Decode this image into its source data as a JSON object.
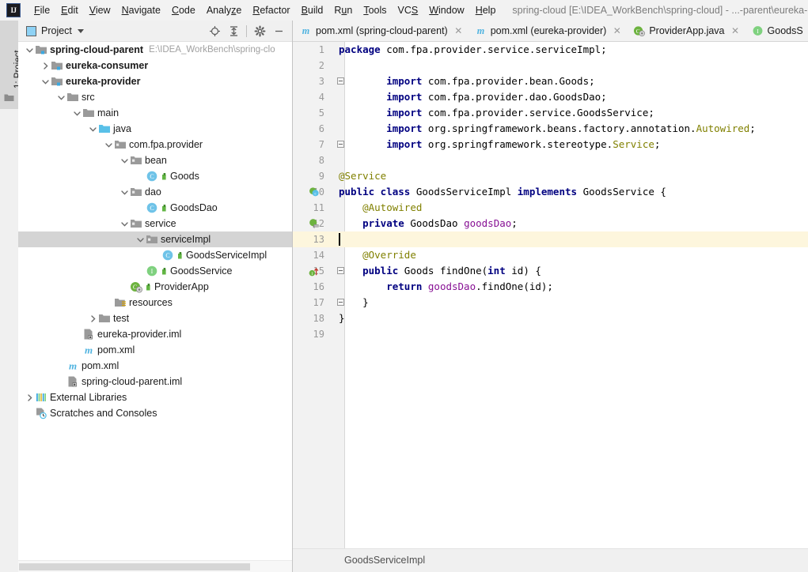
{
  "window": {
    "title": "spring-cloud [E:\\IDEA_WorkBench\\spring-cloud] - ...-parent\\eureka-p",
    "logo": "intellij-idea-logo"
  },
  "menubar": {
    "items": [
      {
        "label": "File",
        "mnemonic": "F"
      },
      {
        "label": "Edit",
        "mnemonic": "E"
      },
      {
        "label": "View",
        "mnemonic": "V"
      },
      {
        "label": "Navigate",
        "mnemonic": "N"
      },
      {
        "label": "Code",
        "mnemonic": "C"
      },
      {
        "label": "Analyze",
        "mnemonic": "z"
      },
      {
        "label": "Refactor",
        "mnemonic": "R"
      },
      {
        "label": "Build",
        "mnemonic": "B"
      },
      {
        "label": "Run",
        "mnemonic": "u"
      },
      {
        "label": "Tools",
        "mnemonic": "T"
      },
      {
        "label": "VCS",
        "mnemonic": "S"
      },
      {
        "label": "Window",
        "mnemonic": "W"
      },
      {
        "label": "Help",
        "mnemonic": "H"
      }
    ]
  },
  "toolstrip": {
    "project_tab": "1: Project",
    "project_tab_num": "1",
    "project_tab_rest": ": Project"
  },
  "project_panel": {
    "title": "Project",
    "tools": [
      {
        "name": "locate-icon",
        "label": "Select Opened File"
      },
      {
        "name": "collapse-all-icon",
        "label": "Collapse All"
      },
      {
        "name": "gear-icon",
        "label": "Settings"
      },
      {
        "name": "minimize-icon",
        "label": "Hide"
      }
    ],
    "tree": [
      {
        "label": "spring-cloud-parent",
        "path": "E:\\IDEA_WorkBench\\spring-clo",
        "depth": 0,
        "arrow": "down",
        "icon": "module-folder-icon",
        "bold": true,
        "badge": false,
        "selected": false
      },
      {
        "label": "eureka-consumer",
        "path": "",
        "depth": 1,
        "arrow": "right",
        "icon": "module-folder-icon",
        "bold": true,
        "badge": false,
        "selected": false
      },
      {
        "label": "eureka-provider",
        "path": "",
        "depth": 1,
        "arrow": "down",
        "icon": "module-folder-icon",
        "bold": true,
        "badge": false,
        "selected": false
      },
      {
        "label": "src",
        "path": "",
        "depth": 2,
        "arrow": "down",
        "icon": "folder-icon",
        "bold": false,
        "badge": false,
        "selected": false
      },
      {
        "label": "main",
        "path": "",
        "depth": 3,
        "arrow": "down",
        "icon": "folder-icon",
        "bold": false,
        "badge": false,
        "selected": false
      },
      {
        "label": "java",
        "path": "",
        "depth": 4,
        "arrow": "down",
        "icon": "source-root-folder-icon",
        "bold": false,
        "badge": false,
        "selected": false
      },
      {
        "label": "com.fpa.provider",
        "path": "",
        "depth": 5,
        "arrow": "down",
        "icon": "package-icon",
        "bold": false,
        "badge": false,
        "selected": false
      },
      {
        "label": "bean",
        "path": "",
        "depth": 6,
        "arrow": "down",
        "icon": "package-icon",
        "bold": false,
        "badge": false,
        "selected": false
      },
      {
        "label": "Goods",
        "path": "",
        "depth": 7,
        "arrow": "none",
        "icon": "java-class-icon",
        "bold": false,
        "badge": true,
        "selected": false
      },
      {
        "label": "dao",
        "path": "",
        "depth": 6,
        "arrow": "down",
        "icon": "package-icon",
        "bold": false,
        "badge": false,
        "selected": false
      },
      {
        "label": "GoodsDao",
        "path": "",
        "depth": 7,
        "arrow": "none",
        "icon": "java-class-icon",
        "bold": false,
        "badge": true,
        "selected": false
      },
      {
        "label": "service",
        "path": "",
        "depth": 6,
        "arrow": "down",
        "icon": "package-icon",
        "bold": false,
        "badge": false,
        "selected": false
      },
      {
        "label": "serviceImpl",
        "path": "",
        "depth": 7,
        "arrow": "down",
        "icon": "package-icon",
        "bold": false,
        "badge": false,
        "selected": true
      },
      {
        "label": "GoodsServiceImpl",
        "path": "",
        "depth": 8,
        "arrow": "none",
        "icon": "java-class-icon",
        "bold": false,
        "badge": true,
        "selected": false
      },
      {
        "label": "GoodsService",
        "path": "",
        "depth": 7,
        "arrow": "none",
        "icon": "java-interface-icon",
        "bold": false,
        "badge": true,
        "selected": false
      },
      {
        "label": "ProviderApp",
        "path": "",
        "depth": 6,
        "arrow": "none",
        "icon": "spring-boot-class-icon",
        "bold": false,
        "badge": true,
        "selected": false
      },
      {
        "label": "resources",
        "path": "",
        "depth": 5,
        "arrow": "none",
        "icon": "resources-folder-icon",
        "bold": false,
        "badge": false,
        "selected": false
      },
      {
        "label": "test",
        "path": "",
        "depth": 4,
        "arrow": "right",
        "icon": "folder-icon",
        "bold": false,
        "badge": false,
        "selected": false
      },
      {
        "label": "eureka-provider.iml",
        "path": "",
        "depth": 3,
        "arrow": "none",
        "icon": "iml-file-icon",
        "bold": false,
        "badge": false,
        "selected": false
      },
      {
        "label": "pom.xml",
        "path": "",
        "depth": 3,
        "arrow": "none",
        "icon": "maven-file-icon",
        "bold": false,
        "badge": false,
        "selected": false
      },
      {
        "label": "pom.xml",
        "path": "",
        "depth": 2,
        "arrow": "none",
        "icon": "maven-file-icon",
        "bold": false,
        "badge": false,
        "selected": false
      },
      {
        "label": "spring-cloud-parent.iml",
        "path": "",
        "depth": 2,
        "arrow": "none",
        "icon": "iml-file-icon",
        "bold": false,
        "badge": false,
        "selected": false
      },
      {
        "label": "External Libraries",
        "path": "",
        "depth": 0,
        "arrow": "right",
        "icon": "libraries-icon",
        "bold": false,
        "badge": false,
        "selected": false
      },
      {
        "label": "Scratches and Consoles",
        "path": "",
        "depth": 0,
        "arrow": "none",
        "icon": "scratches-icon",
        "bold": false,
        "badge": false,
        "selected": false
      }
    ]
  },
  "editor": {
    "tabs": [
      {
        "label": "pom.xml (spring-cloud-parent)",
        "icon": "maven-file-icon",
        "active": false,
        "closable": true
      },
      {
        "label": "pom.xml (eureka-provider)",
        "icon": "maven-file-icon",
        "active": false,
        "closable": true
      },
      {
        "label": "ProviderApp.java",
        "icon": "spring-boot-class-icon",
        "active": false,
        "closable": true
      },
      {
        "label": "GoodsS",
        "icon": "java-interface-icon",
        "active": false,
        "closable": false
      }
    ],
    "breadcrumb": "GoodsServiceImpl",
    "current_line": 13,
    "lines": [
      {
        "num": "1",
        "gutter": "",
        "fold": false,
        "tokens": [
          {
            "t": "package ",
            "c": "kw"
          },
          {
            "t": "com.fpa.provider.service.serviceImpl;",
            "c": "pln"
          }
        ]
      },
      {
        "num": "2",
        "gutter": "",
        "fold": false,
        "tokens": []
      },
      {
        "num": "3",
        "gutter": "",
        "fold": true,
        "tokens": [
          {
            "t": "        ",
            "c": "pln"
          },
          {
            "t": "import ",
            "c": "kw"
          },
          {
            "t": "com.fpa.provider.bean.Goods;",
            "c": "pln"
          }
        ]
      },
      {
        "num": "4",
        "gutter": "",
        "fold": false,
        "tokens": [
          {
            "t": "        ",
            "c": "pln"
          },
          {
            "t": "import ",
            "c": "kw"
          },
          {
            "t": "com.fpa.provider.dao.GoodsDao;",
            "c": "pln"
          }
        ]
      },
      {
        "num": "5",
        "gutter": "",
        "fold": false,
        "tokens": [
          {
            "t": "        ",
            "c": "pln"
          },
          {
            "t": "import ",
            "c": "kw"
          },
          {
            "t": "com.fpa.provider.service.GoodsService;",
            "c": "pln"
          }
        ]
      },
      {
        "num": "6",
        "gutter": "",
        "fold": false,
        "tokens": [
          {
            "t": "        ",
            "c": "pln"
          },
          {
            "t": "import ",
            "c": "kw"
          },
          {
            "t": "org.springframework.beans.factory.annotation.",
            "c": "pln"
          },
          {
            "t": "Autowired",
            "c": "ann"
          },
          {
            "t": ";",
            "c": "pln"
          }
        ]
      },
      {
        "num": "7",
        "gutter": "",
        "fold": true,
        "tokens": [
          {
            "t": "        ",
            "c": "pln"
          },
          {
            "t": "import ",
            "c": "kw"
          },
          {
            "t": "org.springframework.stereotype.",
            "c": "pln"
          },
          {
            "t": "Service",
            "c": "ann"
          },
          {
            "t": ";",
            "c": "pln"
          }
        ]
      },
      {
        "num": "8",
        "gutter": "",
        "fold": false,
        "tokens": []
      },
      {
        "num": "9",
        "gutter": "",
        "fold": false,
        "tokens": [
          {
            "t": "@Service",
            "c": "ann"
          }
        ]
      },
      {
        "num": "10",
        "gutter": "spring-bean-icon",
        "fold": false,
        "tokens": [
          {
            "t": "public class ",
            "c": "kw"
          },
          {
            "t": "GoodsServiceImpl ",
            "c": "pln"
          },
          {
            "t": "implements ",
            "c": "kw"
          },
          {
            "t": "GoodsService {",
            "c": "pln"
          }
        ]
      },
      {
        "num": "11",
        "gutter": "",
        "fold": false,
        "tokens": [
          {
            "t": "    ",
            "c": "pln"
          },
          {
            "t": "@Autowired",
            "c": "ann"
          }
        ]
      },
      {
        "num": "12",
        "gutter": "autowired-icon",
        "fold": false,
        "tokens": [
          {
            "t": "    ",
            "c": "pln"
          },
          {
            "t": "private ",
            "c": "kw"
          },
          {
            "t": "GoodsDao ",
            "c": "pln"
          },
          {
            "t": "goodsDao",
            "c": "fld"
          },
          {
            "t": ";",
            "c": "pln"
          }
        ]
      },
      {
        "num": "13",
        "gutter": "",
        "fold": false,
        "tokens": []
      },
      {
        "num": "14",
        "gutter": "",
        "fold": false,
        "tokens": [
          {
            "t": "    ",
            "c": "pln"
          },
          {
            "t": "@Override",
            "c": "ann"
          }
        ]
      },
      {
        "num": "15",
        "gutter": "implements-method-icon",
        "fold": true,
        "tokens": [
          {
            "t": "    ",
            "c": "pln"
          },
          {
            "t": "public ",
            "c": "kw"
          },
          {
            "t": "Goods findOne(",
            "c": "pln"
          },
          {
            "t": "int ",
            "c": "kw"
          },
          {
            "t": "id) {",
            "c": "pln"
          }
        ]
      },
      {
        "num": "16",
        "gutter": "",
        "fold": false,
        "tokens": [
          {
            "t": "        ",
            "c": "pln"
          },
          {
            "t": "return ",
            "c": "kw"
          },
          {
            "t": "goodsDao",
            "c": "fld"
          },
          {
            "t": ".findOne(id);",
            "c": "pln"
          }
        ]
      },
      {
        "num": "17",
        "gutter": "",
        "fold": true,
        "tokens": [
          {
            "t": "    }",
            "c": "pln"
          }
        ]
      },
      {
        "num": "18",
        "gutter": "",
        "fold": false,
        "tokens": [
          {
            "t": "}",
            "c": "pln"
          }
        ]
      },
      {
        "num": "19",
        "gutter": "",
        "fold": false,
        "tokens": []
      }
    ]
  },
  "colors": {
    "keyword": "#000080",
    "annotation": "#808000",
    "field": "#871094",
    "plain": "#000000",
    "current_line_bg": "#fdf6dd",
    "selection_bg": "#d4d4d4",
    "panel_bg": "#f2f2f2",
    "editor_bg": "#ffffff"
  }
}
